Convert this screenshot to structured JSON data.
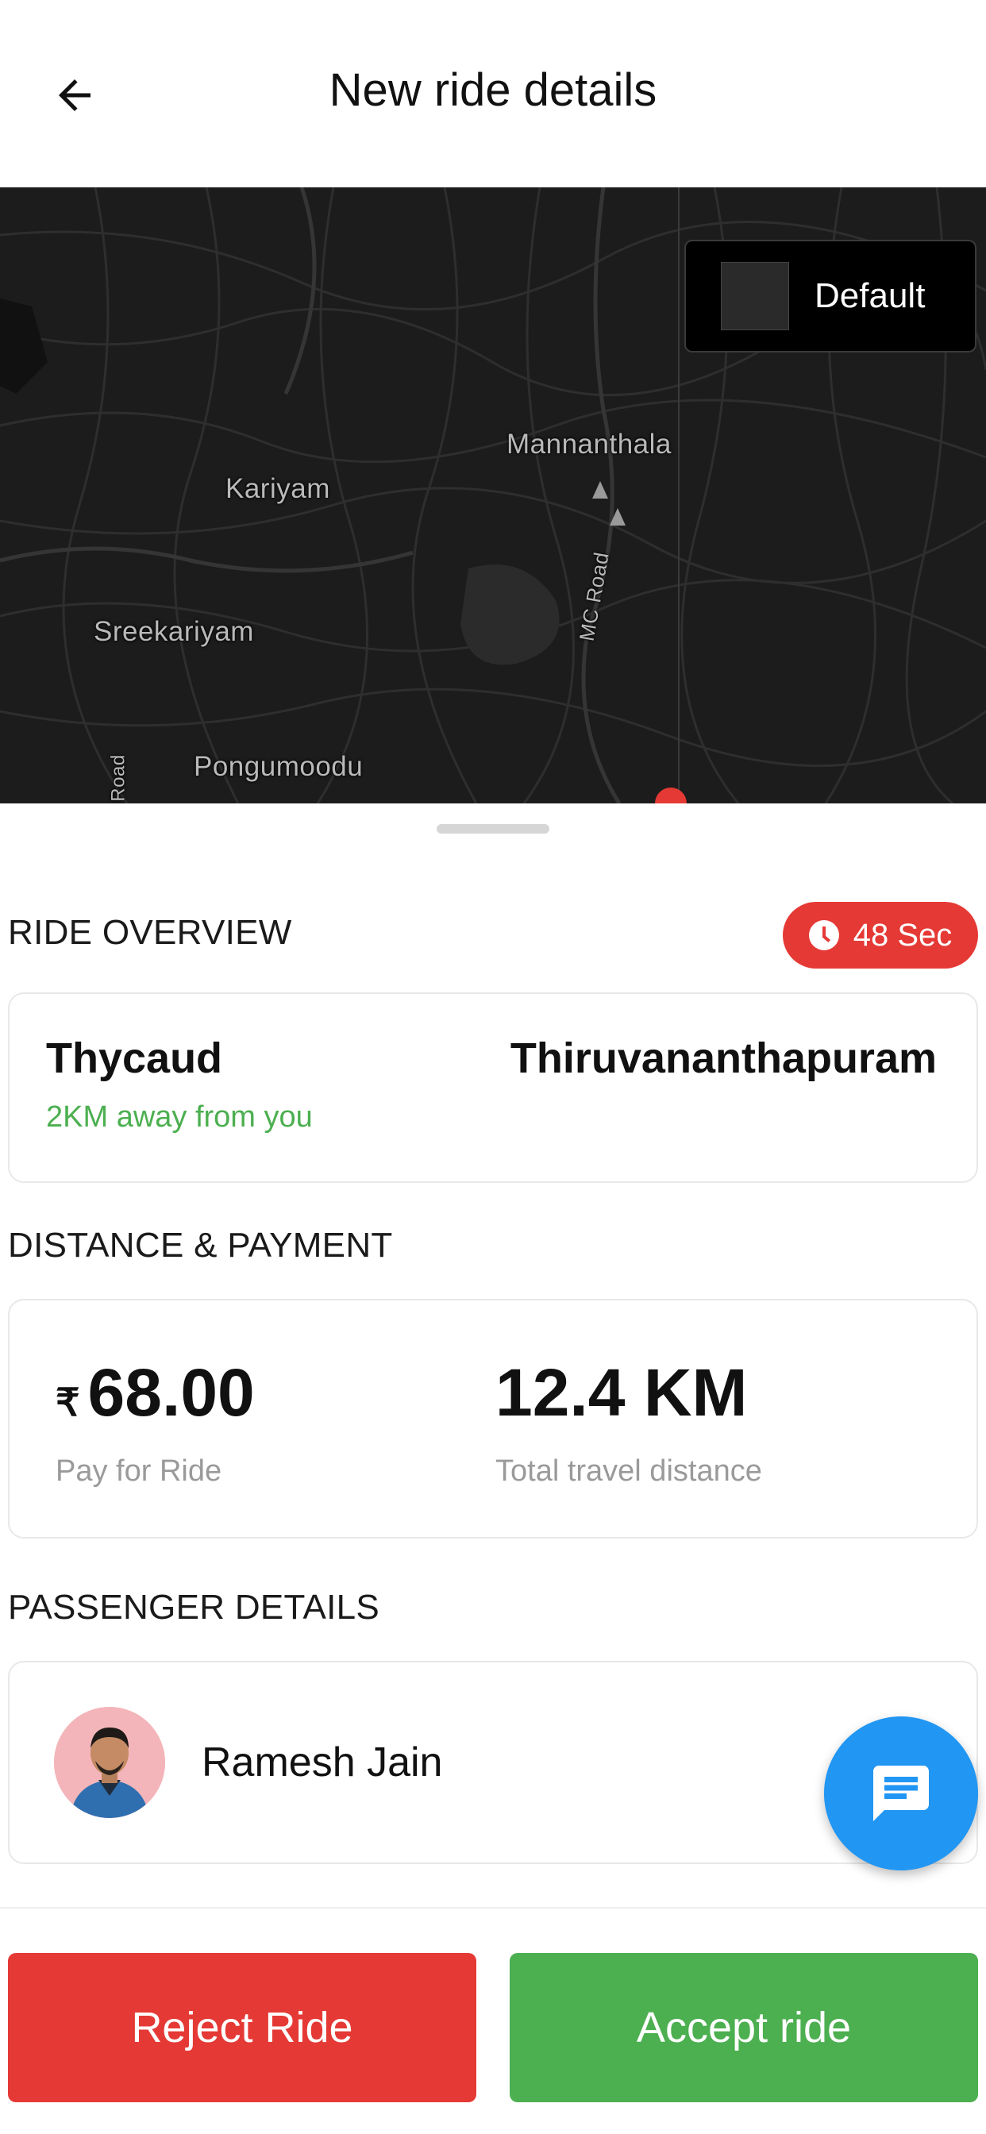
{
  "header": {
    "title": "New ride details",
    "back_icon": "arrow-left-icon"
  },
  "map": {
    "type_button_label": "Default",
    "labels": {
      "mannanthala": "Mannanthala",
      "kariyam": "Kariyam",
      "sreekariyam": "Sreekariyam",
      "pongumoodu": "Pongumoodu",
      "mc_road": "MC Road",
      "road": "Road"
    }
  },
  "overview": {
    "section_title": "RIDE OVERVIEW",
    "timer_icon": "clock-icon",
    "timer_label": "48 Sec",
    "pickup": "Thycaud",
    "pickup_distance": "2KM away from you",
    "drop": "Thiruvananthapuram"
  },
  "payment": {
    "section_title": "DISTANCE & PAYMENT",
    "currency_symbol": "₹",
    "amount": "68.00",
    "amount_label": "Pay for Ride",
    "distance": "12.4 KM",
    "distance_label": "Total travel distance"
  },
  "passenger": {
    "section_title": "PASSENGER DETAILS",
    "name": "Ramesh Jain",
    "chat_icon": "chat-icon"
  },
  "actions": {
    "reject_label": "Reject Ride",
    "accept_label": "Accept ride"
  },
  "colors": {
    "reject": "#e53935",
    "accept": "#4caf50",
    "timer": "#e53935",
    "chat_fab": "#2196f3",
    "distance_text": "#4caf50"
  }
}
